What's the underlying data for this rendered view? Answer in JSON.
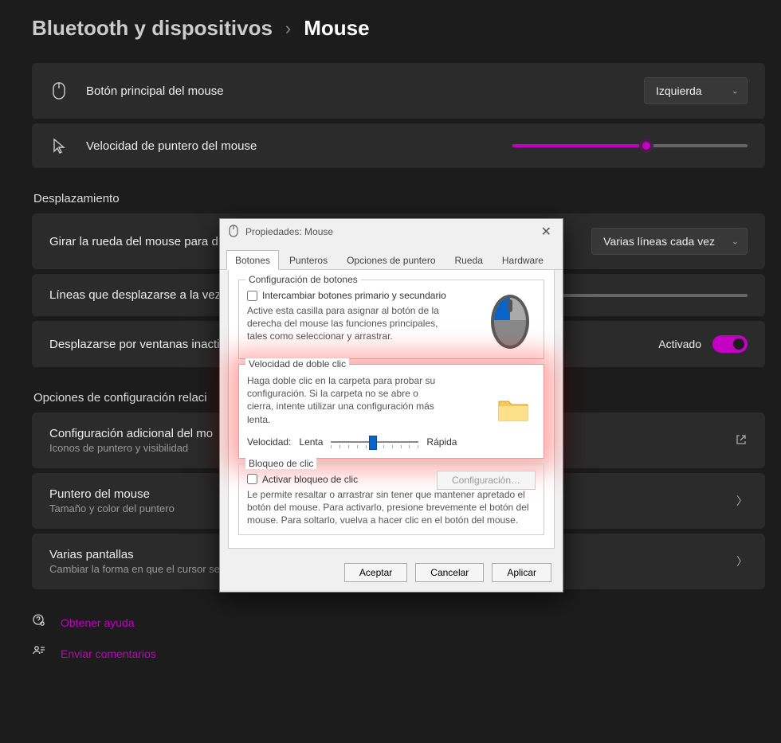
{
  "breadcrumb": {
    "parent": "Bluetooth y dispositivos",
    "separator": "›",
    "current": "Mouse"
  },
  "primary_button": {
    "label": "Botón principal del mouse",
    "value": "Izquierda"
  },
  "pointer_speed": {
    "label": "Velocidad de puntero del mouse",
    "percent": 57
  },
  "scroll": {
    "heading": "Desplazamiento",
    "wheel": {
      "label": "Girar la rueda del mouse para d",
      "value": "Varias líneas cada vez"
    },
    "lines": {
      "label": "Líneas que desplazarse a la vez",
      "percent": 12
    },
    "inactive": {
      "label": "Desplazarse por ventanas inacti",
      "state_label": "Activado",
      "on": true
    }
  },
  "related": {
    "heading": "Opciones de configuración relaci",
    "items": [
      {
        "title": "Configuración adicional del mo",
        "sub": "Iconos de puntero y visibilidad",
        "ext": true
      },
      {
        "title": "Puntero del mouse",
        "sub": "Tamaño y color del puntero",
        "ext": false
      },
      {
        "title": "Varias pantallas",
        "sub": "Cambiar la forma en que el cursor se mueve por encima de los límites de visualización",
        "ext": false
      }
    ]
  },
  "links": {
    "help": "Obtener ayuda",
    "feedback": "Enviar comentarios"
  },
  "dialog": {
    "title": "Propiedades: Mouse",
    "tabs": [
      "Botones",
      "Punteros",
      "Opciones de puntero",
      "Rueda",
      "Hardware"
    ],
    "active_tab": 0,
    "buttons_group": {
      "title": "Configuración de botones",
      "swap_label": "Intercambiar botones primario y secundario",
      "desc": "Active esta casilla para asignar al botón de la derecha del mouse las funciones principales, tales como seleccionar y arrastrar."
    },
    "dblclick_group": {
      "title": "Velocidad de doble clic",
      "desc": "Haga doble clic en la carpeta para probar su configuración. Si la carpeta no se abre o cierra, intente utilizar una configuración más lenta.",
      "speed_label": "Velocidad:",
      "slow": "Lenta",
      "fast": "Rápida",
      "percent": 48
    },
    "clicklock_group": {
      "title": "Bloqueo de clic",
      "enable_label": "Activar bloqueo de clic",
      "config_btn": "Configuración…",
      "desc": "Le permite resaltar o arrastrar sin tener que mantener apretado el botón del mouse. Para activarlo, presione brevemente el botón del mouse. Para soltarlo, vuelva a hacer clic en el botón del mouse."
    },
    "footer": {
      "ok": "Aceptar",
      "cancel": "Cancelar",
      "apply": "Aplicar"
    }
  }
}
